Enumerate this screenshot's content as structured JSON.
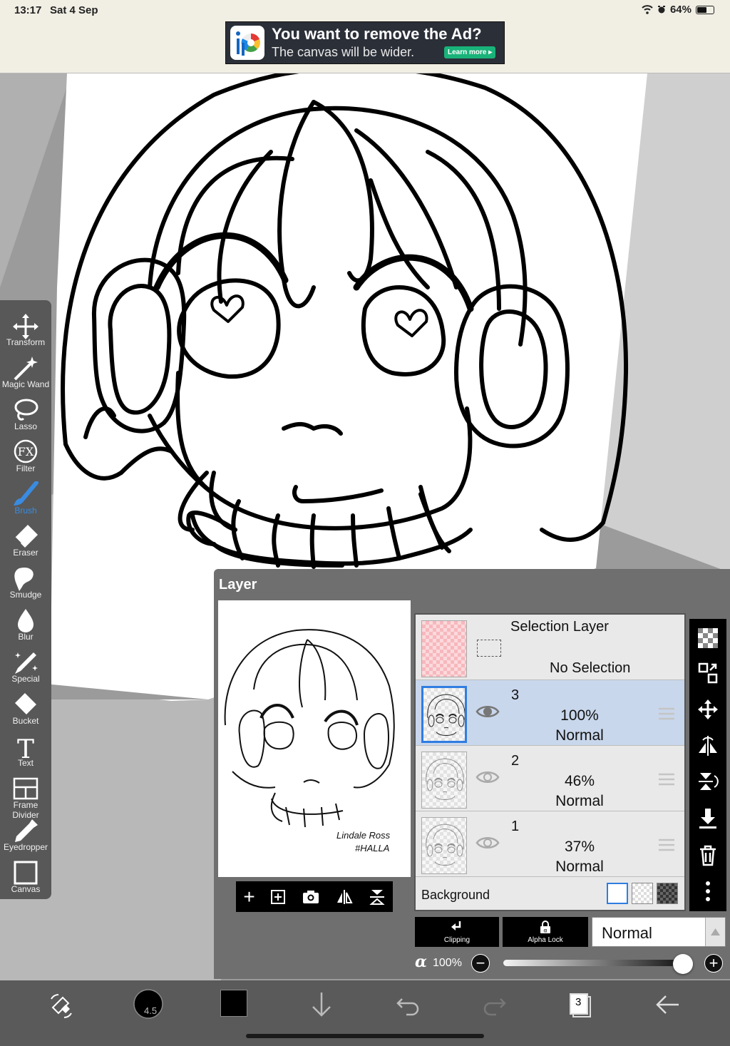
{
  "status_bar": {
    "time": "13:17",
    "date": "Sat 4 Sep",
    "battery": "64%",
    "battery_level": 0.64
  },
  "ad": {
    "title": "You want to remove the Ad?",
    "subtitle": "The canvas will be wider.",
    "cta": "Learn more ▸"
  },
  "toolbar": {
    "tools": [
      {
        "label": "Transform",
        "icon": "move-arrows-icon"
      },
      {
        "label": "Magic Wand",
        "icon": "magic-wand-icon"
      },
      {
        "label": "Lasso",
        "icon": "lasso-icon"
      },
      {
        "label": "Filter",
        "icon": "fx-icon",
        "icon_text": "FX"
      },
      {
        "label": "Brush",
        "icon": "brush-icon",
        "active": true
      },
      {
        "label": "Eraser",
        "icon": "eraser-icon"
      },
      {
        "label": "Smudge",
        "icon": "smudge-icon"
      },
      {
        "label": "Blur",
        "icon": "blur-drop-icon"
      },
      {
        "label": "Special",
        "icon": "special-pen-icon"
      },
      {
        "label": "Bucket",
        "icon": "bucket-icon"
      },
      {
        "label": "Text",
        "icon": "text-icon",
        "icon_text": "T"
      },
      {
        "label": "Frame Divider",
        "icon": "frame-divider-icon"
      },
      {
        "label": "Eyedropper",
        "icon": "eyedropper-icon"
      },
      {
        "label": "Canvas",
        "icon": "canvas-icon"
      }
    ]
  },
  "layer_panel": {
    "title": "Layer",
    "preview_signature": [
      "Lindale Ross",
      "#HALLA"
    ],
    "selection_layer": {
      "title": "Selection Layer",
      "status": "No Selection"
    },
    "layers": [
      {
        "number": "3",
        "opacity": "100%",
        "mode": "Normal",
        "selected": true
      },
      {
        "number": "2",
        "opacity": "46%",
        "mode": "Normal",
        "selected": false
      },
      {
        "number": "1",
        "opacity": "37%",
        "mode": "Normal",
        "selected": false
      }
    ],
    "background_label": "Background",
    "clipping_label": "Clipping",
    "alpha_lock_label": "Alpha Lock",
    "blend_mode": "Normal",
    "alpha_symbol": "α",
    "alpha_value": "100%",
    "alpha_fraction": 1.0
  },
  "bottom_bar": {
    "brush_size": "4.5",
    "layer_count": "3",
    "primary_color": "#000000"
  },
  "colors": {
    "accent": "#2f7de1",
    "selected_row": "#c9d7ec",
    "toolbar": "#585858",
    "panel": "#6f6f6f"
  }
}
